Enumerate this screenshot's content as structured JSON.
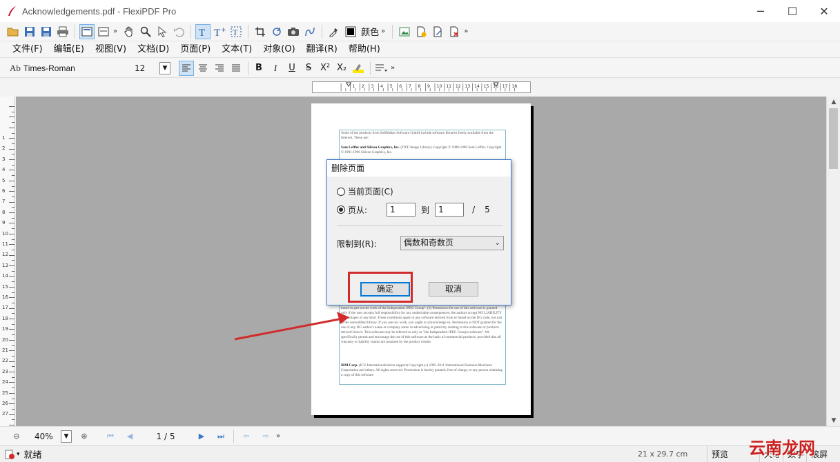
{
  "window": {
    "title": "Acknowledgements.pdf - FlexiPDF Pro",
    "minimize": "─",
    "maximize": "☐",
    "close": "✕"
  },
  "toolbar": {
    "color_label": "颜色",
    "more": "»"
  },
  "menu": {
    "items": [
      "文件(F)",
      "编辑(E)",
      "视图(V)",
      "文档(D)",
      "页面(P)",
      "文本(T)",
      "对象(O)",
      "翻译(R)",
      "帮助(H)"
    ]
  },
  "format": {
    "font_icon": "Ab",
    "font_name": "Times-Roman",
    "font_size": "12",
    "bold": "B",
    "italic": "I",
    "underline": "U",
    "strike": "S",
    "superscript": "X²",
    "subscript": "X₂"
  },
  "ruler": {
    "h_ticks": [
      "1",
      "2",
      "3",
      "4",
      "5",
      "6",
      "7",
      "8",
      "9",
      "10",
      "11",
      "12",
      "13",
      "14",
      "15",
      "16",
      "17",
      "18"
    ],
    "v_ticks": [
      "1",
      "2",
      "3",
      "4",
      "5",
      "6",
      "7",
      "8",
      "9",
      "10",
      "11",
      "12",
      "13",
      "14",
      "15",
      "16",
      "17",
      "18",
      "19",
      "20",
      "21",
      "22",
      "23",
      "24",
      "25",
      "26",
      "27"
    ]
  },
  "document": {
    "p1": "Some of the products from SoftMaker Software GmbH include software libraries freely available from the Internet. These are:",
    "h2": "Sam Leffler and Silicon Graphics, Inc.",
    "p2": " (TIFF Image Library) Copyright © 1988-1996 Sam Leffler. Copyright © 1991-1996 Silicon Graphics, Inc.",
    "p3": "based in part on the work of the Independent JPEG Group\". (3) Permission for use of this software is granted only if the user accepts full responsibility for any undesirable consequences; the authors accept NO LIABILITY for damages of any kind. These conditions apply to any software derived from or based on the IJG code, not just to the unmodified library. If you use our work, you ought to acknowledge us. Permission is NOT granted for the use of any IJG author's name or company name in advertising or publicity relating to this software or products derived from it. This software may be referred to only as \"the Independent JPEG Group's software\". We specifically permit and encourage the use of this software as the basis of commercial products, provided that all warranty or liability claims are assumed by the product vendor.",
    "h4": "IBM Corp.",
    "p4": " (ICU Internationalization support) Copyright (c) 1995-2011 International Business Machines Corporation and others. All rights reserved. Permission is hereby granted, free of charge, to any person obtaining a copy of this software"
  },
  "dialog": {
    "title": "删除页面",
    "current_page": "当前页面(C)",
    "pages_from": "页从:",
    "from_value": "1",
    "to_label": "到",
    "to_value": "1",
    "slash": "/",
    "total": "5",
    "limit_label": "限制到(R):",
    "limit_value": "偶数和奇数页",
    "ok": "确定",
    "cancel": "取消"
  },
  "nav": {
    "zoom": "40%",
    "page": "1 / 5"
  },
  "status": {
    "ready": "就绪",
    "page_size": "21 x 29.7 cm",
    "preview": "预览",
    "caps": "大写",
    "num": "数字",
    "scroll": "滚屏"
  },
  "watermark": "云南龙网",
  "colors": {
    "accent": "#0078d7",
    "highlight": "#d22b2b",
    "canvas": "#a9a9a9"
  }
}
